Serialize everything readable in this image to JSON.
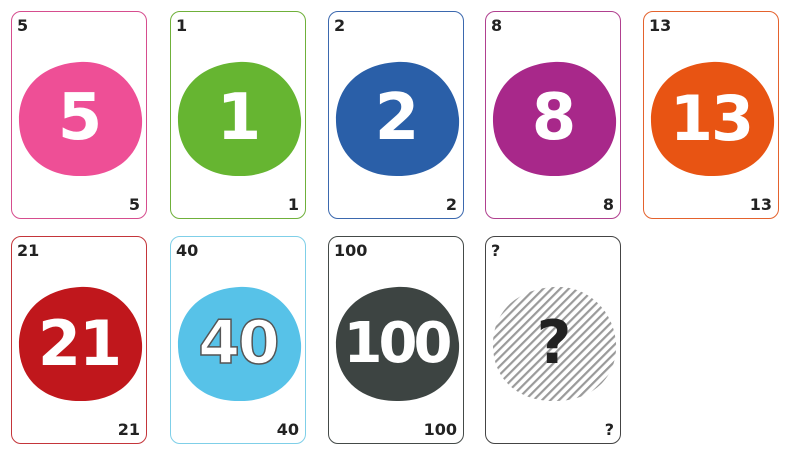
{
  "cards": [
    {
      "label": "5",
      "color": "#ee4f96",
      "border": "#d64d8e",
      "text_color": "#ffffff"
    },
    {
      "label": "1",
      "color": "#66b531",
      "border": "#6fb03a",
      "text_color": "#ffffff"
    },
    {
      "label": "2",
      "color": "#2a5fa8",
      "border": "#3b68ae",
      "text_color": "#ffffff"
    },
    {
      "label": "8",
      "color": "#a8288a",
      "border": "#b0408f",
      "text_color": "#ffffff"
    },
    {
      "label": "13",
      "color": "#e85413",
      "border": "#e4622d",
      "text_color": "#ffffff"
    },
    {
      "label": "21",
      "color": "#c0171c",
      "border": "#c4353a",
      "text_color": "#ffffff"
    },
    {
      "label": "40",
      "color": "#57c2e8",
      "border": "#7fcfe8",
      "text_color": "#ffffff"
    },
    {
      "label": "100",
      "color": "#3d4442",
      "border": "#444a48",
      "text_color": "#ffffff"
    },
    {
      "label": "?",
      "color": "hatched",
      "border": "#444444",
      "text_color": "#222222"
    }
  ]
}
